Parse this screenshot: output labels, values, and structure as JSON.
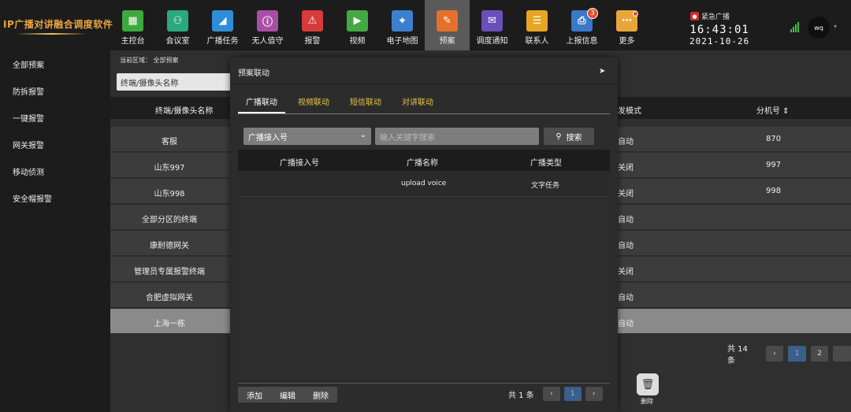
{
  "app": {
    "title": "IP广播对讲融合调度软件"
  },
  "nav": [
    {
      "label": "主控台",
      "icon": "dashboard-icon",
      "color": "#3da93d",
      "glyph": "▦"
    },
    {
      "label": "会议室",
      "icon": "meeting-icon",
      "color": "#2ba87e",
      "glyph": "⚇"
    },
    {
      "label": "广播任务",
      "icon": "broadcast-icon",
      "color": "#2d8ed6",
      "glyph": "◢"
    },
    {
      "label": "无人值守",
      "icon": "unattended-icon",
      "color": "#a84fa5",
      "glyph": "ⓘ"
    },
    {
      "label": "报警",
      "icon": "alarm-icon",
      "color": "#d63a3a",
      "glyph": "⚠"
    },
    {
      "label": "视频",
      "icon": "video-icon",
      "color": "#44a844",
      "glyph": "▶"
    },
    {
      "label": "电子地图",
      "icon": "map-icon",
      "color": "#3b7fd0",
      "glyph": "⌖"
    },
    {
      "label": "预案",
      "icon": "plan-icon",
      "color": "#e3712c",
      "glyph": "✎"
    },
    {
      "label": "调度通知",
      "icon": "notice-icon",
      "color": "#6a4fb8",
      "glyph": "✉"
    },
    {
      "label": "联系人",
      "icon": "contacts-icon",
      "color": "#e6a623",
      "glyph": "☰"
    },
    {
      "label": "上报信息",
      "icon": "report-icon",
      "color": "#3a78c8",
      "glyph": "⎙",
      "badge": "3"
    },
    {
      "label": "更多",
      "icon": "more-icon",
      "color": "#e8a63a",
      "glyph": "⋯"
    }
  ],
  "header": {
    "emergency_label": "紧急广播",
    "time": "16:43:01",
    "date": "2021-10-26",
    "user": "wq"
  },
  "sidebar": [
    "全部预案",
    "防拆报警",
    "一键报警",
    "网关报警",
    "移动侦测",
    "安全帽报警"
  ],
  "main": {
    "breadcrumb": "当前区域： 全部预案",
    "filter_value": "终端/摄像头名称",
    "columns": [
      "终端/摄像头名称",
      "发模式",
      "分机号 ⇕"
    ],
    "rows": [
      {
        "name": "客服",
        "mode": "自动",
        "ext": "870"
      },
      {
        "name": "山东997",
        "mode": "关闭",
        "ext": "997"
      },
      {
        "name": "山东998",
        "mode": "关闭",
        "ext": "998"
      },
      {
        "name": "全部分区的终端",
        "mode": "自动",
        "ext": ""
      },
      {
        "name": "康耐德网关",
        "mode": "自动",
        "ext": ""
      },
      {
        "name": "管理员专属报警终端",
        "mode": "关闭",
        "ext": ""
      },
      {
        "name": "合肥虚拟网关",
        "mode": "自动",
        "ext": ""
      },
      {
        "name": "上海一栋",
        "mode": "自动",
        "ext": ""
      }
    ],
    "pager": {
      "total": "共 14 条",
      "prev": "‹",
      "pages": [
        "1",
        "2"
      ]
    },
    "delete_label": "删除"
  },
  "modal": {
    "title": "预案联动",
    "tabs": [
      "广播联动",
      "视频联动",
      "短信联动",
      "对讲联动"
    ],
    "select_value": "广播接入号",
    "search_placeholder": "输入关键字搜索",
    "search_button": "搜索",
    "columns": [
      "广播接入号",
      "广播名称",
      "广播类型"
    ],
    "rows": [
      {
        "access": "",
        "name": "upload voice",
        "type": "文字任务"
      }
    ],
    "footer_buttons": [
      "添加",
      "编辑",
      "删除"
    ],
    "pager": {
      "total": "共 1 条",
      "prev": "‹",
      "page": "1",
      "next": "›"
    }
  }
}
